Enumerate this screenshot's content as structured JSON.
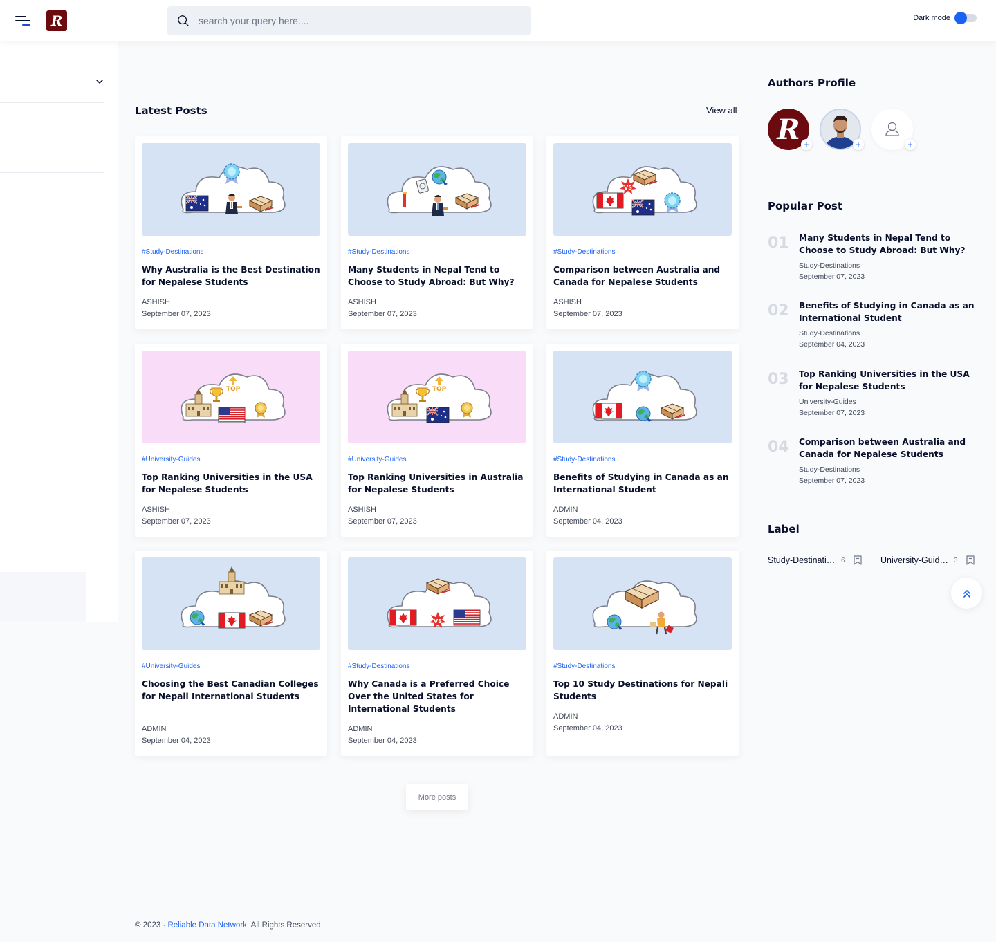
{
  "header": {
    "logo_letter": "R",
    "search_placeholder": "search your query here....",
    "dark_mode_label": "Dark mode"
  },
  "main": {
    "latest_title": "Latest Posts",
    "view_all": "View all",
    "more_posts": "More posts",
    "posts": [
      {
        "tag": "#Study-Destinations",
        "title": "Why Australia is the Best Destination for Nepalese Students",
        "author": "ASHISH",
        "date": "September 07, 2023",
        "bg": "#d6e3f5",
        "items": [
          "au-flag",
          "student",
          "books",
          "badge"
        ]
      },
      {
        "tag": "#Study-Destinations",
        "title": "Many Students in Nepal Tend to Choose to Study Abroad: But Why?",
        "author": "ASHISH",
        "date": "September 07, 2023",
        "bg": "#d6e3f5",
        "items": [
          "tools",
          "passport",
          "student",
          "books",
          "globe"
        ]
      },
      {
        "tag": "#Study-Destinations",
        "title": "Comparison between Australia and Canada for Nepalese Students",
        "author": "ASHISH",
        "date": "September 07, 2023",
        "bg": "#d6e3f5",
        "items": [
          "ca-flag",
          "vs",
          "au-flag",
          "badge",
          "books"
        ]
      },
      {
        "tag": "#University-Guides",
        "title": "Top Ranking Universities in the USA for Nepalese Students",
        "author": "ASHISH",
        "date": "September 07, 2023",
        "bg": "#f8dcf8",
        "items": [
          "building",
          "trophy",
          "us-flag",
          "medal",
          "top"
        ]
      },
      {
        "tag": "#University-Guides",
        "title": "Top Ranking Universities in Australia for Nepalese Students",
        "author": "ASHISH",
        "date": "September 07, 2023",
        "bg": "#f8dcf8",
        "items": [
          "building",
          "trophy",
          "au-flag",
          "medal",
          "top"
        ]
      },
      {
        "tag": "#Study-Destinations",
        "title": "Benefits of Studying in Canada as an International Student",
        "author": "ADMIN",
        "date": "September 04, 2023",
        "bg": "#d6e3f5",
        "items": [
          "ca-flag",
          "globe",
          "books",
          "badge"
        ]
      },
      {
        "tag": "#University-Guides",
        "title": "Choosing the Best Canadian Colleges for Nepali International Students",
        "author": "ADMIN",
        "date": "September 04, 2023",
        "bg": "#d6e3f5",
        "items": [
          "globe",
          "ca-flag",
          "books",
          "building"
        ]
      },
      {
        "tag": "#Study-Destinations",
        "title": "Why Canada is a Preferred Choice Over the United States for International Students",
        "author": "ADMIN",
        "date": "September 04, 2023",
        "bg": "#d6e3f5",
        "items": [
          "ca-flag",
          "vs",
          "us-flag",
          "books"
        ]
      },
      {
        "tag": "#Study-Destinations",
        "title": "Top 10 Study Destinations for Nepali Students",
        "author": "ADMIN",
        "date": "September 04, 2023",
        "bg": "#d6e3f5",
        "items": [
          "globe",
          "traveler",
          "books-big"
        ]
      }
    ]
  },
  "aside": {
    "authors_title": "Authors Profile",
    "popular_title": "Popular Post",
    "label_title": "Label",
    "popular": [
      {
        "num": "01",
        "title": "Many Students in Nepal Tend to Choose to Study Abroad: But Why?",
        "category": "Study-Destinations",
        "date": "September 07, 2023"
      },
      {
        "num": "02",
        "title": "Benefits of Studying in Canada as an International Student",
        "category": "Study-Destinations",
        "date": "September 04, 2023"
      },
      {
        "num": "03",
        "title": "Top Ranking Universities in the USA for Nepalese Students",
        "category": "University-Guides",
        "date": "September 07, 2023"
      },
      {
        "num": "04",
        "title": "Comparison between Australia and Canada for Nepalese Students",
        "category": "Study-Destinations",
        "date": "September 07, 2023"
      }
    ],
    "labels": [
      {
        "name": "Study-Destinations",
        "count": "6"
      },
      {
        "name": "University-Guides",
        "count": "3"
      }
    ]
  },
  "footer": {
    "prefix": "© 2023 · ",
    "link": "Reliable Data Network",
    "suffix": ". All Rights Reserved"
  },
  "colors": {
    "accent": "#1b62f4",
    "brand": "#6b0b10",
    "text": "#08102b"
  }
}
